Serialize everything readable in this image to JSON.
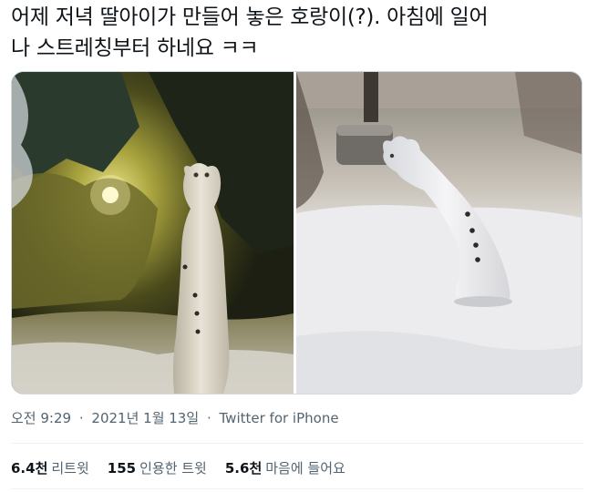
{
  "tweet": {
    "text_line1": "어제 저녁 딸아이가 만들어 놓은 호랑이(?). 아침에 일어",
    "text_line2": "나 스트레칭부터 하네요 ㅋㅋ"
  },
  "media": {
    "photo_left": "night-snow-tiger-photo",
    "photo_right": "morning-snow-tiger-photo"
  },
  "meta": {
    "time": "오전 9:29",
    "date": "2021년 1월 13일",
    "separator": "·",
    "source": "Twitter for iPhone"
  },
  "stats": {
    "retweets_count": "6.4천",
    "retweets_label": "리트윗",
    "quotes_count": "155",
    "quotes_label": "인용한 트윗",
    "likes_count": "5.6천",
    "likes_label": "마음에 들어요"
  }
}
